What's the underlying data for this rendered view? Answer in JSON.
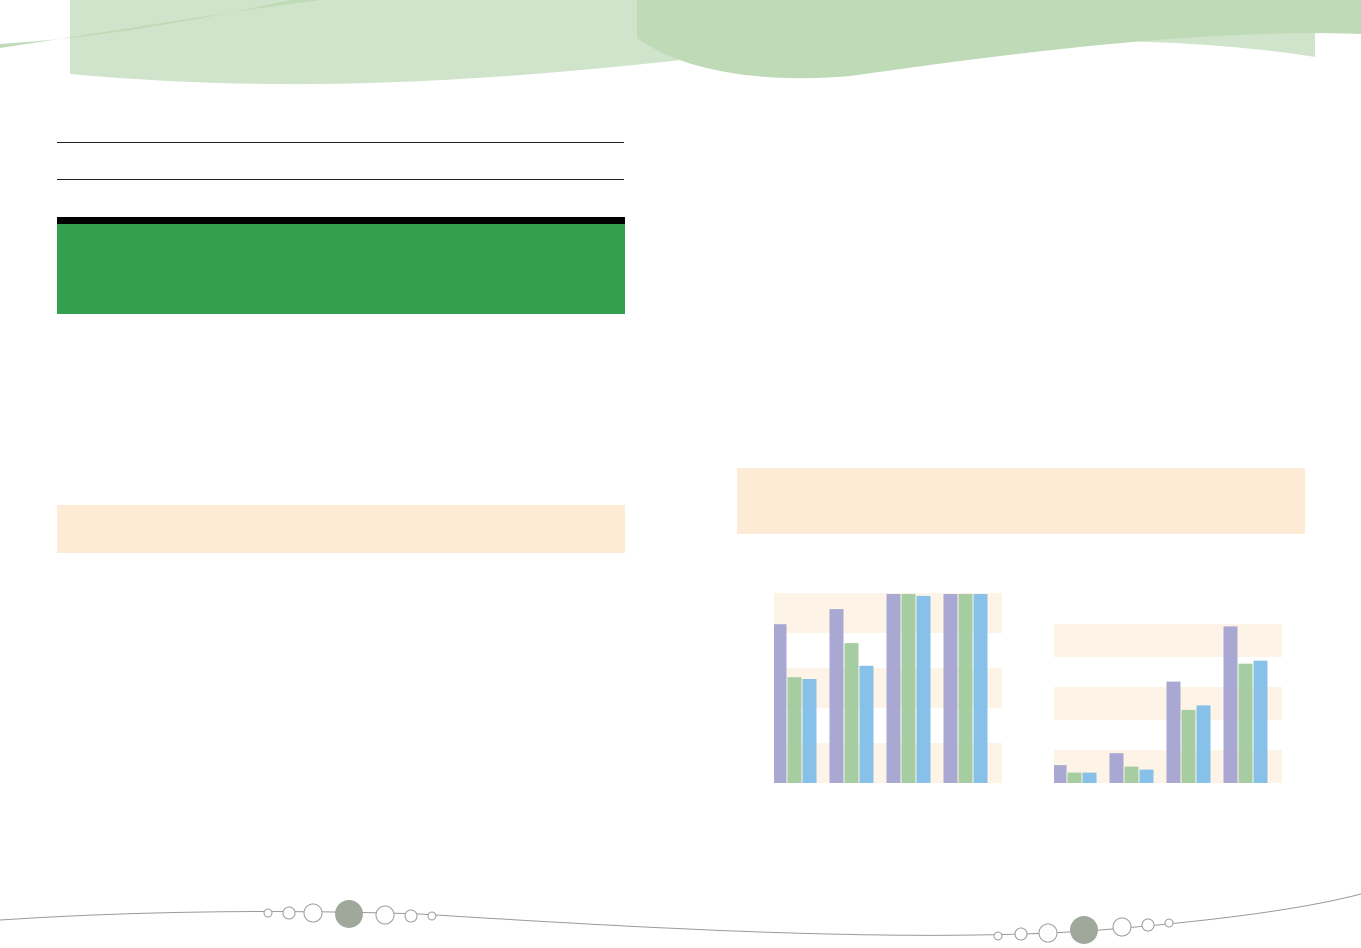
{
  "theme": {
    "header_green_light": "#d0e4cb",
    "header_green_mid": "#bedab6",
    "banner_green": "#34a04f",
    "band_peach": "#fdebd6",
    "chart_band": "#fdf3e6",
    "series_colors": [
      "#a9a8d3",
      "#a6cda1",
      "#87c1ea"
    ],
    "footer_dot_fill": "#a0a89c"
  },
  "footer": {
    "left_dot_icon": "active-page-dot-icon",
    "right_dot_icon": "active-page-dot-icon"
  },
  "chart_data": [
    {
      "type": "bar",
      "categories": [
        "",
        "",
        "",
        ""
      ],
      "series": [
        {
          "values": [
            84,
            92,
            100,
            100
          ]
        },
        {
          "values": [
            56,
            74,
            100,
            100
          ]
        },
        {
          "values": [
            55,
            62,
            99,
            100
          ]
        }
      ],
      "ylim": [
        0,
        100
      ],
      "grid": true
    },
    {
      "type": "bar",
      "categories": [
        "",
        "",
        "",
        ""
      ],
      "series": [
        {
          "values": [
            12,
            20,
            68,
            105
          ]
        },
        {
          "values": [
            7,
            11,
            49,
            80
          ]
        },
        {
          "values": [
            7,
            9,
            52,
            82
          ]
        }
      ],
      "ylim": [
        0,
        120
      ],
      "grid": true
    }
  ]
}
